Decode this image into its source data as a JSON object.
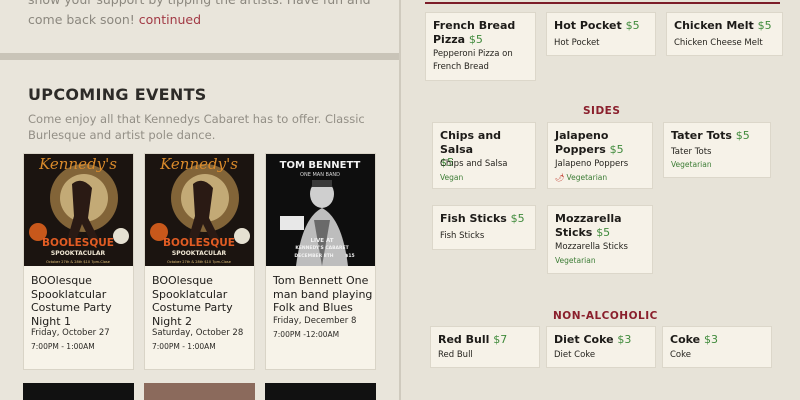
{
  "intro": {
    "text": "show your support by tipping the artists. Have fun and come back soon!",
    "link": "continued"
  },
  "events": {
    "heading": "UPCOMING EVENTS",
    "subheading": "Come enjoy all that Kennedys Cabaret has to offer. Classic Burlesque and artist pole dance.",
    "cards": [
      {
        "title": "BOOlesque Spooklatcular Costume Party Night 1",
        "date": "Friday, October 27",
        "time": "7:00PM - 1:00AM",
        "poster": {
          "brand": "Kennedy's",
          "headline": "BOOLESQUE",
          "sub": "SPOOKTACULAR",
          "footer": "October 27th & 28th $10 7pm-Close"
        }
      },
      {
        "title": "BOOlesque Spooklatcular Costume Party Night 2",
        "date": "Saturday, October 28",
        "time": "7:00PM - 1:00AM",
        "poster": {
          "brand": "Kennedy's",
          "headline": "BOOLESQUE",
          "sub": "SPOOKTACULAR",
          "footer": "October 27th & 28th $10 7pm-Close"
        }
      },
      {
        "title": "Tom Bennett One man band playing Folk and Blues",
        "date": "Friday, December 8",
        "time": "7:00PM -12:00AM",
        "poster": {
          "name": "TOM BENNETT",
          "tagline": "ONE MAN BAND",
          "live": "LIVE AT",
          "venue": "KENNEDY'S CABARET",
          "date": "DECEMBER 8TH",
          "price": "$15"
        }
      }
    ]
  },
  "menu": {
    "top_items": [
      {
        "name": "French Bread Pizza",
        "price": "$5",
        "desc": "Pepperoni Pizza on French Bread"
      },
      {
        "name": "Hot Pocket",
        "price": "$5",
        "desc": "Hot Pocket"
      },
      {
        "name": "Chicken Melt",
        "price": "$5",
        "desc": "Chicken Cheese Melt"
      }
    ],
    "sides_heading": "SIDES",
    "sides": [
      {
        "name": "Chips and Salsa",
        "price": "$5",
        "desc": "Chips and Salsa",
        "tag": "Vegan"
      },
      {
        "name": "Jalapeno Poppers",
        "price": "$5",
        "desc": "Jalapeno Poppers",
        "tag": "Vegetarian",
        "spicy": "🌶"
      },
      {
        "name": "Tater Tots",
        "price": "$5",
        "desc": "Tater Tots",
        "tag": "Vegetarian"
      },
      {
        "name": "Fish Sticks",
        "price": "$5",
        "desc": "Fish Sticks"
      },
      {
        "name": "Mozzarella Sticks",
        "price": "$5",
        "desc": "Mozzarella Sticks",
        "tag": "Vegetarian"
      }
    ],
    "nonalc_heading": "NON-ALCOHOLIC",
    "drinks": [
      {
        "name": "Red Bull",
        "price": "$7",
        "desc": "Red Bull"
      },
      {
        "name": "Diet Coke",
        "price": "$3",
        "desc": "Diet Coke"
      },
      {
        "name": "Coke",
        "price": "$3",
        "desc": "Coke"
      }
    ]
  },
  "colors": {
    "accent": "#8a1f2c",
    "price": "#3f8a3b",
    "background": "#e7e3d8",
    "card": "#f6f2e8"
  }
}
